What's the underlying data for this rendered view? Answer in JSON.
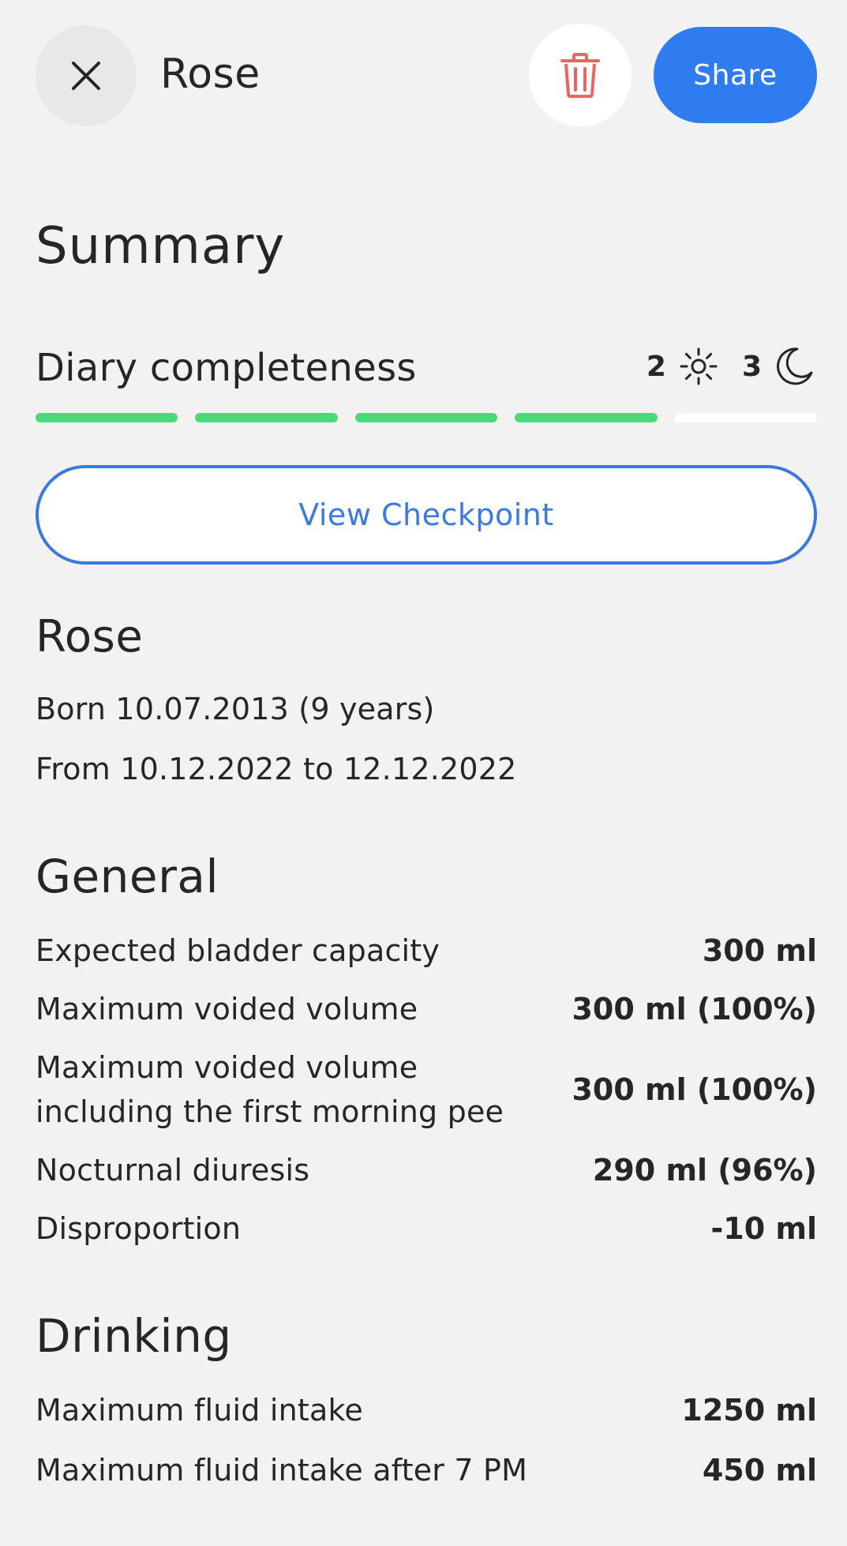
{
  "header": {
    "title": "Rose",
    "share_label": "Share",
    "icons": {
      "close": "close-icon",
      "delete": "trash-icon"
    }
  },
  "summary": {
    "title": "Summary",
    "completeness_label": "Diary completeness",
    "day_count": "2",
    "night_count": "3",
    "segments_total": 5,
    "segments_completed": 4,
    "view_checkpoint_label": "View Checkpoint"
  },
  "patient": {
    "name": "Rose",
    "born": "Born 10.07.2013 (9 years)",
    "range": "From 10.12.2022  to 12.12.2022"
  },
  "general": {
    "title": "General",
    "rows": [
      {
        "label": "Expected bladder capacity",
        "value": "300 ml"
      },
      {
        "label": "Maximum voided volume",
        "value": "300 ml (100%)"
      },
      {
        "label": "Maximum voided volume including the first morning pee",
        "value": "300 ml (100%)"
      },
      {
        "label": "Nocturnal diuresis",
        "value": "290 ml (96%)"
      },
      {
        "label": "Disproportion",
        "value": "-10 ml"
      }
    ]
  },
  "drinking": {
    "title": "Drinking",
    "rows": [
      {
        "label": "Maximum fluid intake",
        "value": "1250 ml"
      },
      {
        "label": "Maximum fluid intake after 7 PM",
        "value": "450 ml"
      }
    ]
  },
  "colors": {
    "accent": "#2f7bf0",
    "progress_done": "#4cd97b",
    "delete": "#e8665f",
    "background": "#f2f2f2"
  }
}
